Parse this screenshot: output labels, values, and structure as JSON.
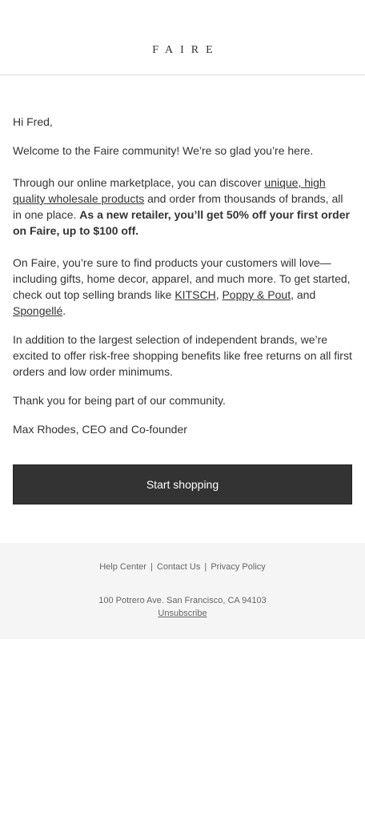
{
  "header": {
    "logo": "FAIRE"
  },
  "email": {
    "greeting": "Hi Fred,",
    "welcome": "Welcome to the Faire community! We’re so glad you’re here.",
    "market_intro": "Through our online marketplace, you can discover ",
    "market_link": "unique, high quality wholesale products",
    "market_mid": " and order from thousands of brands, all in one place. ",
    "market_bold": "As a new retailer, you’ll get 50% off your first order on Faire, up to $100 off.",
    "brands_intro": "On Faire, you’re sure to find products your customers will love—including gifts, home decor, apparel, and much more. To get started, check out top selling brands like ",
    "brand_1": "KITSCH",
    "brand_sep_1": ", ",
    "brand_2": "Poppy & Pout",
    "brand_sep_2": ", and ",
    "brand_3": "Spongellé",
    "brand_end": ".",
    "benefits": "In addition to the largest selection of independent brands, we’re excited to offer risk-free shopping benefits like free returns on all first orders and low order minimums.",
    "thanks": "Thank you for being part of our community.",
    "signature": "Max Rhodes, CEO and Co-founder"
  },
  "cta": {
    "label": "Start shopping"
  },
  "footer": {
    "links": [
      "Help Center",
      "Contact Us",
      "Privacy Policy"
    ],
    "separator": "|",
    "address": "100 Potrero Ave. San Francisco, CA 94103",
    "unsubscribe": "Unsubscribe"
  },
  "colors": {
    "text": "#333333",
    "button_bg": "#333333",
    "footer_bg": "#f5f5f5"
  }
}
